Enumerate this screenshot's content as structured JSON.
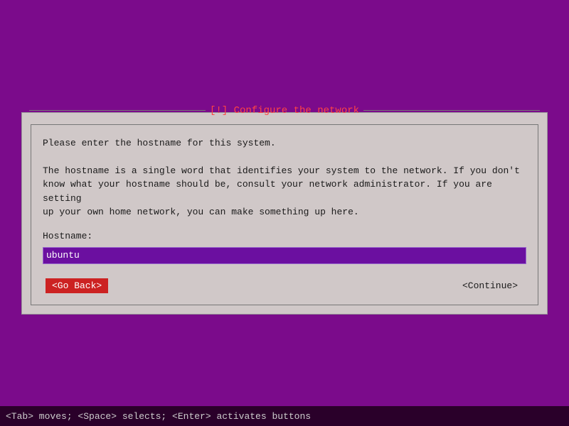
{
  "background_color": "#7b0b8b",
  "dialog": {
    "title": "[!] Configure the network",
    "description_line1": "Please enter the hostname for this system.",
    "description_line2": "",
    "description_line3": "The hostname is a single word that identifies your system to the network. If you don't",
    "description_line4": "know what your hostname should be, consult your network administrator. If you are setting",
    "description_line5": "up your own home network, you can make something up here.",
    "hostname_label": "Hostname:",
    "hostname_value": "ubuntu",
    "go_back_label": "<Go Back>",
    "continue_label": "<Continue>"
  },
  "status_bar": {
    "text": "<Tab> moves; <Space> selects; <Enter> activates buttons"
  }
}
